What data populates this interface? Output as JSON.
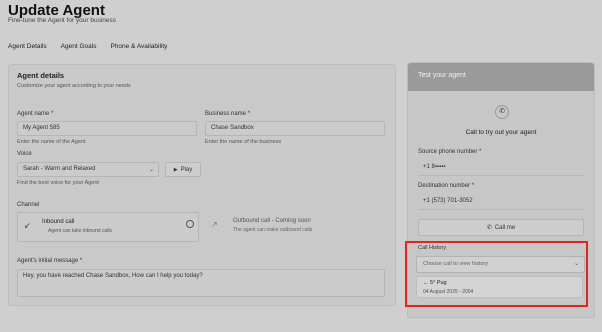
{
  "header": {
    "title": "Update Agent",
    "subtitle": "Fine-tune the Agent for your business"
  },
  "tabs": [
    "Agent Details",
    "Agent Goals",
    "Phone & Availability"
  ],
  "agent_details": {
    "title": "Agent details",
    "subtitle": "Customize your agent according to your needs",
    "agent_name_label": "Agent name *",
    "agent_name_value": "My Agent 585",
    "agent_name_help": "Enter the name of the Agent",
    "business_name_label": "Business name *",
    "business_name_value": "Chase Sandbox",
    "business_name_help": "Enter the name of the business",
    "voice_label": "Voice",
    "voice_value": "Sarah - Warm and Relaxed",
    "play_label": "Play",
    "voice_help": "Find the best voice for your Agent",
    "channel_label": "Channel",
    "inbound_title": "Inbound call",
    "inbound_sub": "Agent can take inbound calls",
    "outbound_title": "Outbound call - Coming soon",
    "outbound_sub": "The agent can make outbound calls",
    "initial_message_label": "Agent's initial message *",
    "initial_message_value": "Hey, you have reached Chase Sandbox, How can I help you today?"
  },
  "test_panel": {
    "title": "Test your agent",
    "call_prompt": "Call to try out your agent",
    "source_label": "Source phone number *",
    "source_value": "+1 8▪▪▪▪▪",
    "dest_label": "Destination number *",
    "dest_value": "+1 (573) 701-3052",
    "call_button": "Call me",
    "history_label": "Call History",
    "history_placeholder": "Choose call to view history",
    "history_item_top": "← 5° Pug",
    "history_item_sub": "04 August 2025 - 2004"
  }
}
